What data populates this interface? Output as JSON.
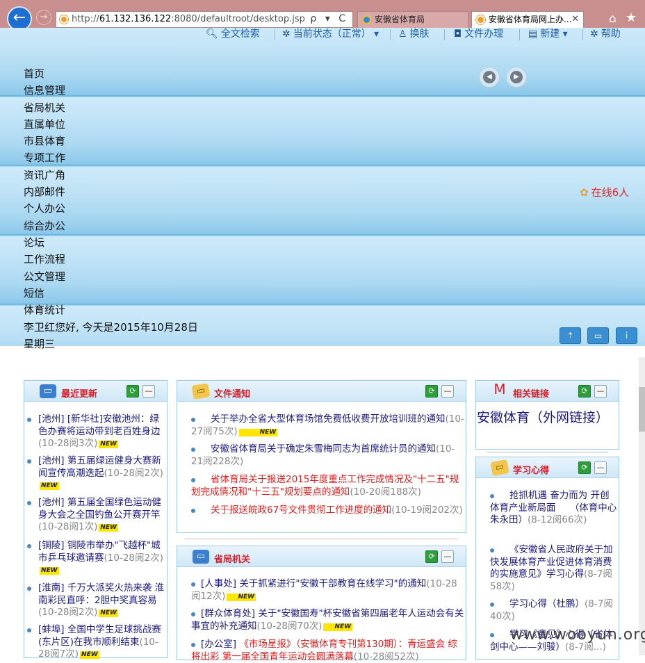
{
  "browser": {
    "url_prefix": "http://",
    "url_host": "61.132.136.122",
    "url_rest": ":8080/defaultroot/desktop.jsp",
    "url_tools": "ρ ▾ C",
    "tabs": [
      {
        "label": "安徽省体育局",
        "active": false
      },
      {
        "label": "安徽省体育局网上办...",
        "active": true
      }
    ],
    "close_glyph": "✕"
  },
  "topmenu": [
    {
      "label": "全文检索",
      "icon": "search-icon"
    },
    {
      "label": "当前状态（正常）",
      "icon": "gear-icon"
    },
    {
      "label": "换肤",
      "icon": "user-icon"
    },
    {
      "label": "文件办理",
      "icon": "mouse-icon"
    },
    {
      "label": "新建",
      "icon": "document-icon"
    },
    {
      "label": "帮助",
      "icon": "help-gear-icon"
    }
  ],
  "nav": [
    "首页",
    "信息管理",
    "省局机关",
    "直属单位",
    "市县体育",
    "专项工作",
    "资讯广角",
    "内部邮件",
    "个人办公",
    "综合办公",
    "论坛",
    "工作流程",
    "公文管理",
    "短信",
    "体育统计"
  ],
  "greeting": {
    "line1": "李卫红您好, 今天是2015年10月28日",
    "line2": "星期三"
  },
  "online": "在线6人",
  "new_badge": "NEW",
  "portlets": {
    "recent": {
      "title": "最近更新",
      "items": [
        {
          "tag": "[池州]",
          "text": "[新华社]安徽池州：绿色办赛将运动带到老百姓身边",
          "meta": "(10-28阅3次)",
          "is_new": true
        },
        {
          "tag": "[池州]",
          "text": "第五届绿运健身大赛新闻宣传高潮迭起",
          "meta": "(10-28阅2次)",
          "is_new": true
        },
        {
          "tag": "[池州]",
          "text": "第五届全国绿色运动健身大会之全国钓鱼公开赛开竿",
          "meta": "(10-28阅1次)",
          "is_new": true
        },
        {
          "tag": "[铜陵]",
          "text": "铜陵市举办\"飞越杯\"城市乒乓球邀请赛",
          "meta": "(10-28阅2次)",
          "is_new": true
        },
        {
          "tag": "[淮南]",
          "text": "千万大派奖火热来袭 淮南彩民直呼：2胆中奖真容易",
          "meta": "(10-28阅2次)",
          "is_new": true
        },
        {
          "tag": "[蚌埠]",
          "text": "全国中学生足球挑战赛(东片区)在我市顺利结束",
          "meta": "(10-28阅7次)",
          "is_new": true
        }
      ]
    },
    "notice": {
      "title": "文件通知",
      "items": [
        {
          "text": "关于举办全省大型体育场馆免费低收费开放培训班的通知",
          "meta": "(10-27阅75次)",
          "is_new": true,
          "red": false
        },
        {
          "text": "安徽省体育局关于确定朱雪梅同志为首席统计员的通知",
          "meta": "(10-21阅228次)",
          "is_new": false,
          "red": false
        },
        {
          "text": "省体育局关于报送2015年度重点工作完成情况及\"十二五\"规划完成情况和\"十三五\"规划要点的通知",
          "meta": "(10-20阅188次)",
          "is_new": false,
          "red": true
        },
        {
          "text": "关于报送皖政67号文件贯彻工作进度的通知",
          "meta": "(10-19阅202次)",
          "is_new": false,
          "red": true
        }
      ]
    },
    "bureau": {
      "title": "省局机关",
      "items": [
        {
          "tag": "[人事处]",
          "text": "关于抓紧进行\"安徽干部教育在线学习\"的通知",
          "meta": "(10-28阅12次)",
          "is_new": true,
          "red": false
        },
        {
          "tag": "[群众体育处]",
          "text": "关于\"安徽国寿\"杯安徽省第四届老年人运动会有关事宜的补充通知",
          "meta": "(10-28阅70次)",
          "is_new": true,
          "red": false
        },
        {
          "tag": "[办公室]",
          "text": "《市场星报》（安徽体育专刊第130期）：青运盛会 综将出彩 第一届全国青年运动会圆满落幕",
          "meta": "(10-28阅52次)",
          "is_new": false,
          "red": true
        }
      ]
    },
    "links": {
      "title": "相关链接",
      "link": "安徽体育（外网链接）"
    },
    "study": {
      "title": "学习心得",
      "items": [
        {
          "text": "抢抓机遇 奋力而为 开创体育产业新局面　　（体育中心　　朱永田）",
          "meta": "(8-12阅66次)"
        },
        {
          "text": "《安徽省人民政府关于加快发展体育产业促进体育消费的实施意见》学习心得",
          "meta": "(8-7阅58次)"
        },
        {
          "text": "学习心得（杜鹏）",
          "meta": "(8-7阅40次)"
        },
        {
          "text": "学习《意见》心得（省体剑中心——刘骏）",
          "meta": "(8-7阅...)"
        }
      ]
    }
  },
  "watermark": "www.wooyun.org"
}
